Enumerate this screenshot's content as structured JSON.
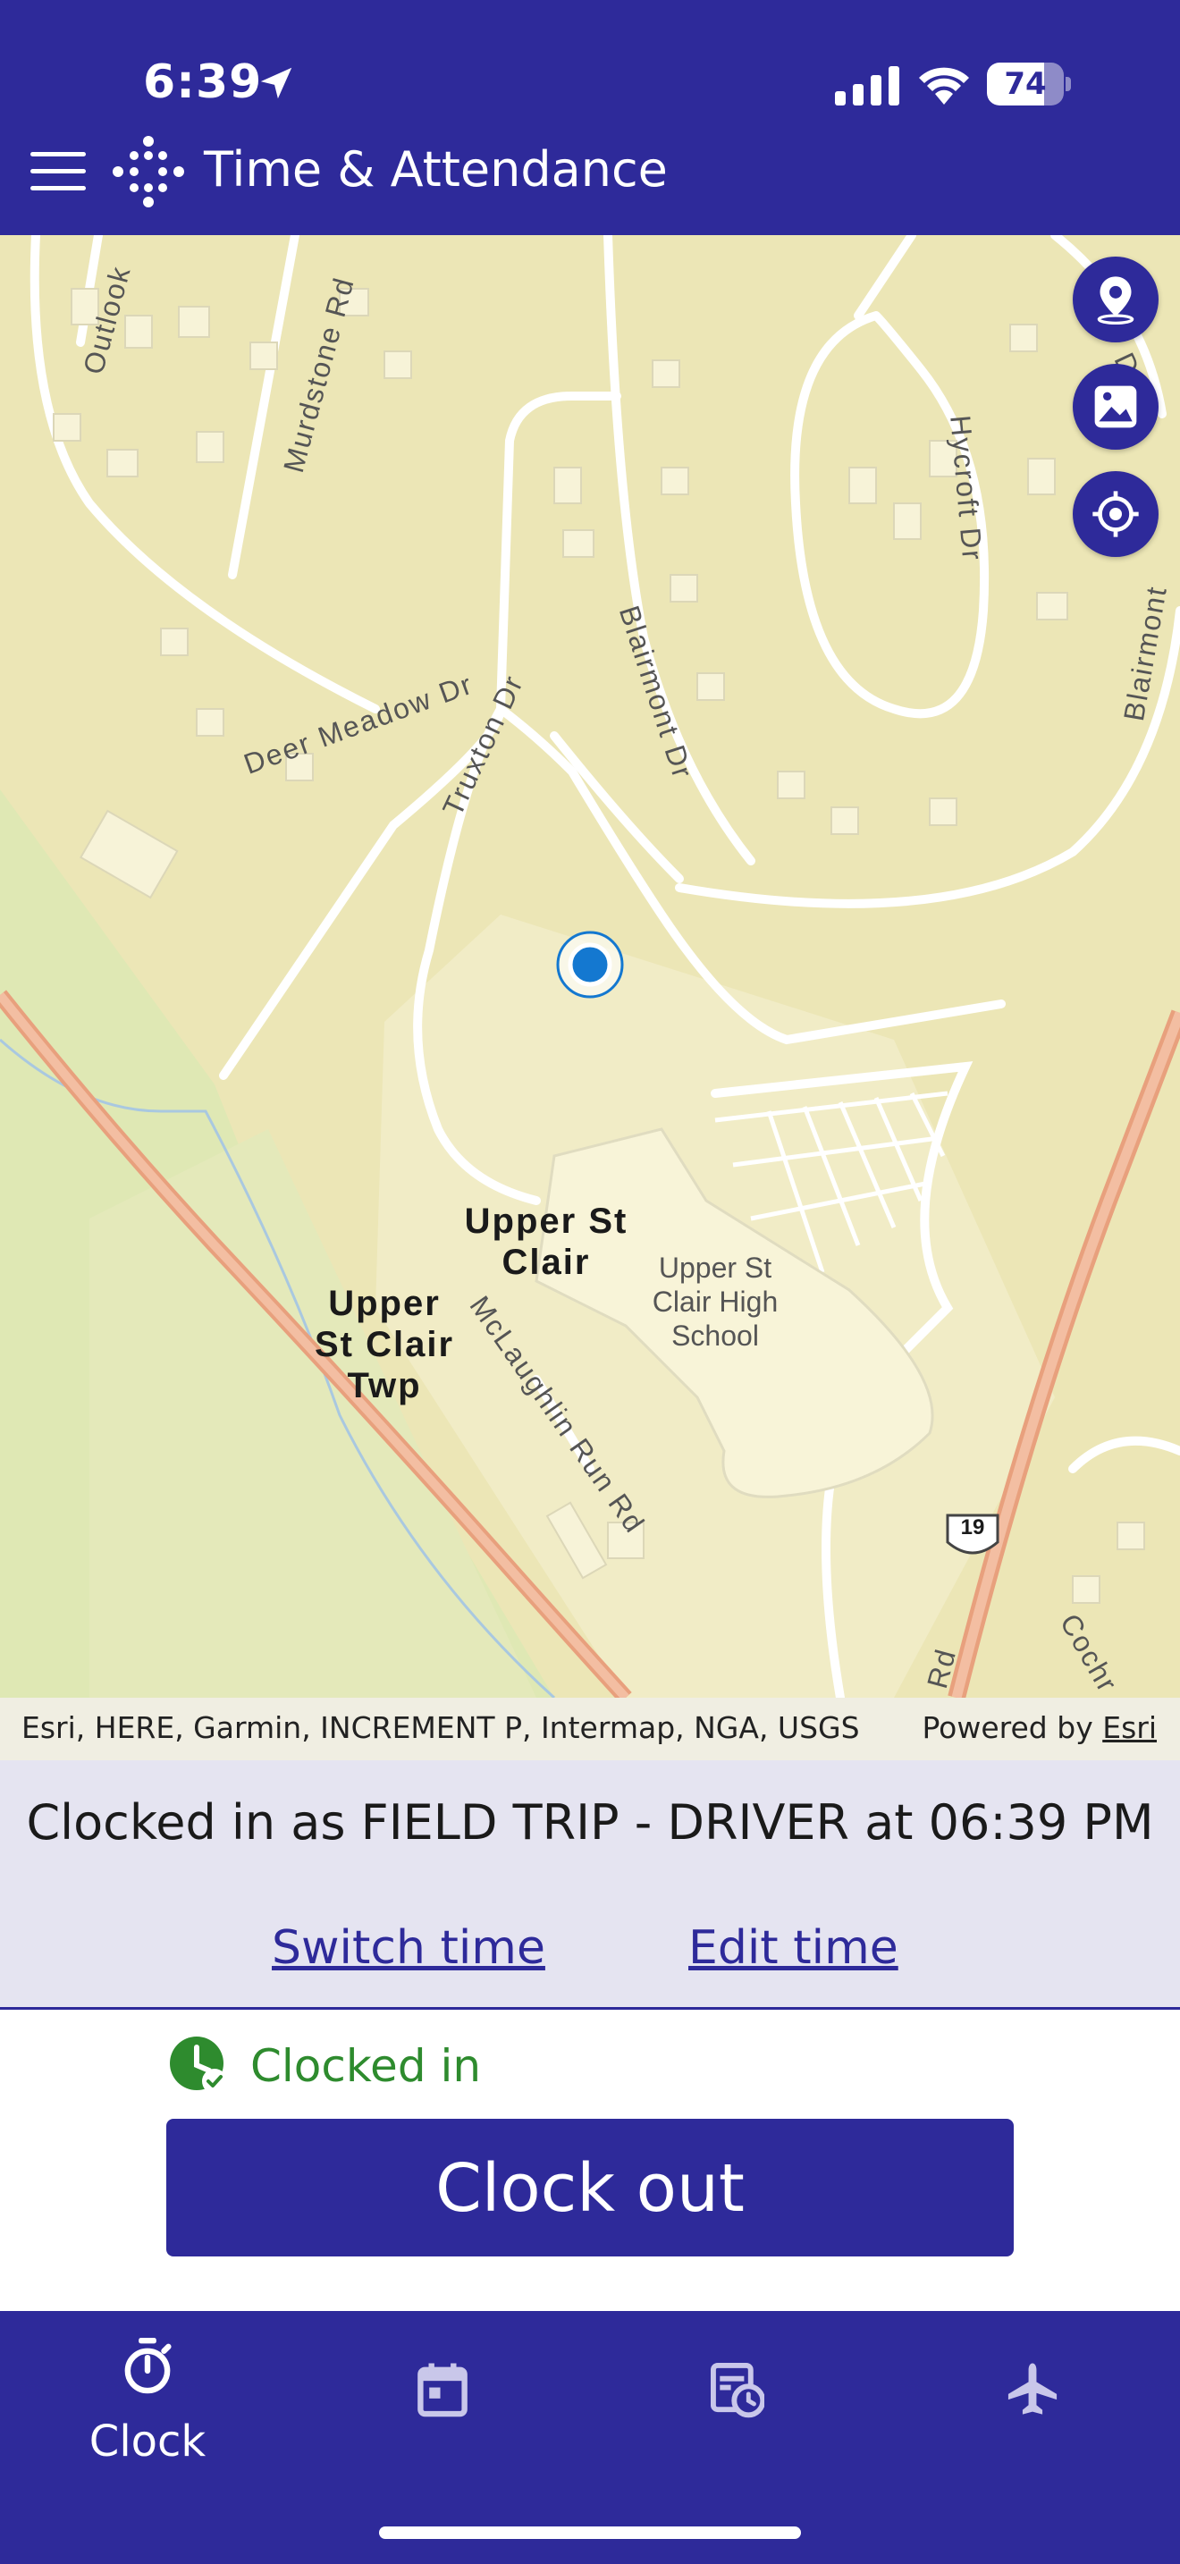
{
  "status_bar": {
    "time": "6:39",
    "battery": "74",
    "battery_level": 0.74
  },
  "header": {
    "title": "Time & Attendance"
  },
  "map": {
    "labels": {
      "place_1": "Upper St\nClair",
      "place_2": "Upper\nSt Clair\nTwp",
      "school": "Upper St\nClair High\nSchool",
      "route_shield": "19"
    },
    "streets": {
      "outlook": "Outlook",
      "murdstone": "Murdstone Rd",
      "hycroft": "Hycroft Dr",
      "blairmont_1": "Blairmont Dr",
      "blairmont_2": "Blairmont",
      "deer_meadow": "Deer Meadow Dr",
      "truxton": "Truxton Dr",
      "mclaughlin": "McLaughlin Run Rd",
      "dev": "Dev",
      "cochr": "Cochr",
      "rd": "Rd"
    },
    "buttons": [
      "location-pin-icon",
      "image-icon",
      "crosshair-icon"
    ],
    "attribution": "Esri, HERE, Garmin, INCREMENT P, Intermap, NGA, USGS",
    "powered_by_prefix": "Powered by ",
    "powered_by_link": "Esri"
  },
  "status": {
    "message": "Clocked in as FIELD TRIP - DRIVER at 06:39 PM",
    "switch_label": "Switch time",
    "edit_label": "Edit time",
    "badge_label": "Clocked in",
    "action_label": "Clock out"
  },
  "tabs": [
    {
      "label": "Clock",
      "icon": "stopwatch-icon"
    },
    {
      "label": "",
      "icon": "calendar-icon"
    },
    {
      "label": "",
      "icon": "schedule-icon"
    },
    {
      "label": "",
      "icon": "airplane-icon"
    }
  ],
  "colors": {
    "brand": "#2e2a9a",
    "success": "#2e8b2e",
    "map_land": "#ece6b6",
    "location_dot": "#1478d0"
  }
}
